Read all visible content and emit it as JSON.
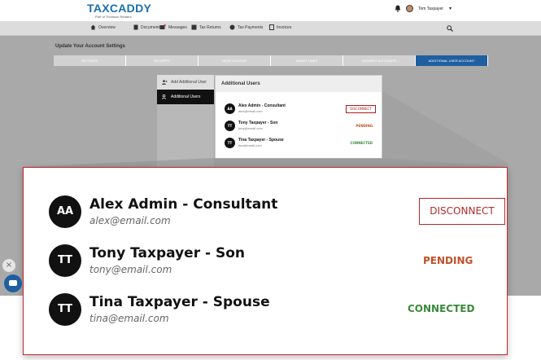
{
  "brand": {
    "logo": "TAXCADDY",
    "tagline": "Part of Thomson Reuters"
  },
  "header": {
    "user_name": "Tom Taxpayer",
    "icons": [
      "bell-icon",
      "avatar",
      "chevron-down-icon"
    ]
  },
  "nav": {
    "items": [
      {
        "label": "Overview",
        "icon": "home-icon"
      },
      {
        "label": "Documents",
        "icon": "documents-icon"
      },
      {
        "label": "Messages",
        "icon": "messages-icon"
      },
      {
        "label": "Tax Returns",
        "icon": "tax-returns-icon"
      },
      {
        "label": "Tax Payments",
        "icon": "tax-payments-icon"
      },
      {
        "label": "Invoices",
        "icon": "invoices-icon"
      }
    ],
    "search_icon": "search-icon"
  },
  "settings": {
    "title": "Update Your Account Settings",
    "tabs": [
      {
        "label": "Settings",
        "active": false
      },
      {
        "label": "Security",
        "active": false
      },
      {
        "label": "Notifications",
        "active": false
      },
      {
        "label": "Smart Links",
        "active": false
      },
      {
        "label": "Payment Accounts",
        "active": false
      },
      {
        "label": "Additional User Account",
        "active": true
      }
    ]
  },
  "sidebar": {
    "items": [
      {
        "label": "Add Additional User",
        "icon": "add-user-icon",
        "active": false
      },
      {
        "label": "Additional Users",
        "icon": "users-icon",
        "active": true
      }
    ]
  },
  "users_panel": {
    "title": "Additional Users",
    "users": [
      {
        "initials": "AA",
        "name": "Alex Admin - Consultant",
        "email": "alex@email.com",
        "action": "DISCONNECT",
        "status": "",
        "status_color": ""
      },
      {
        "initials": "TT",
        "name": "Tony Taxpayer - Son",
        "email": "tony@email.com",
        "action": "",
        "status": "PENDING",
        "status_color": "#c0502a"
      },
      {
        "initials": "TT",
        "name": "Tina Taxpayer - Spouse",
        "email": "tina@email.com",
        "action": "",
        "status": "CONNECTED",
        "status_color": "#3a8a3a"
      }
    ]
  },
  "colors": {
    "accent": "#1f5fa0",
    "danger": "#b02a2a",
    "pending": "#c0502a",
    "connected": "#3a8a3a"
  },
  "widgets": {
    "close_symbol": "×",
    "chat_icon": "chat-icon"
  }
}
